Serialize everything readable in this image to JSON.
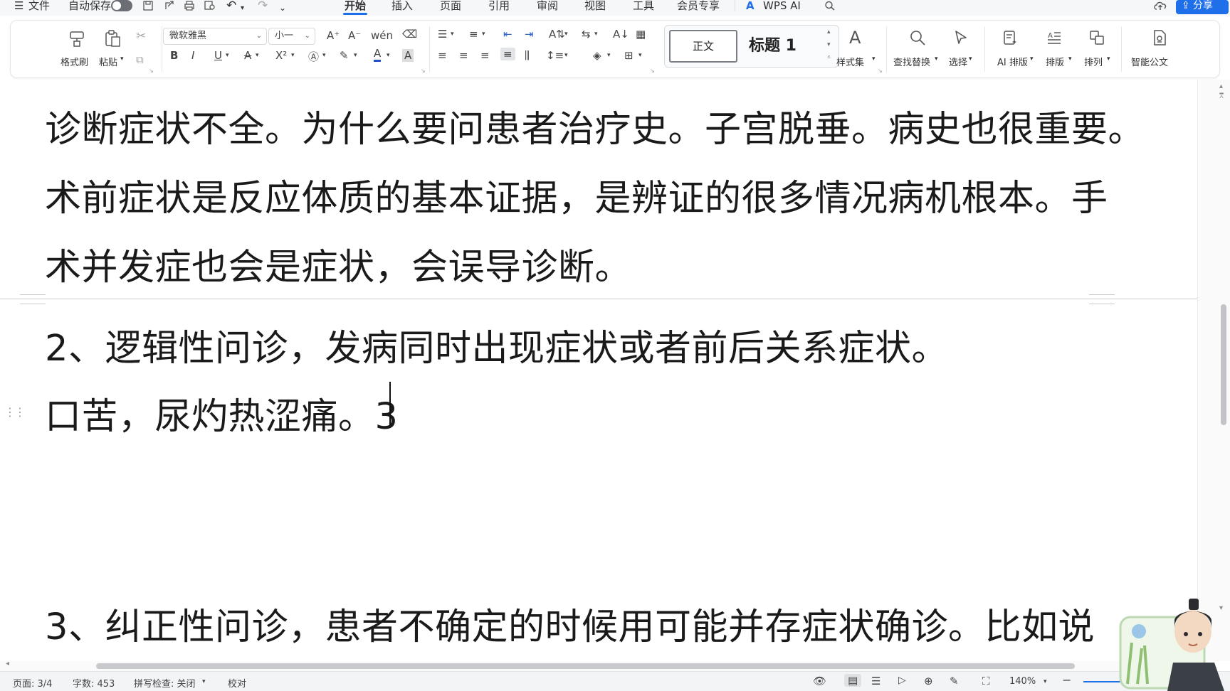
{
  "menubar": {
    "file_label": "文件",
    "autosave_label": "自动保存",
    "tabs": [
      "开始",
      "插入",
      "页面",
      "引用",
      "审阅",
      "视图",
      "工具",
      "会员专享"
    ],
    "wps_ai_label": "WPS AI",
    "share_label": "分享",
    "accent_color": "#1f6feb"
  },
  "ribbon": {
    "format_painter": "格式刷",
    "paste": "粘贴",
    "font_name": "微软雅黑",
    "font_size": "小一",
    "style_normal": "正文",
    "style_heading1": "标题 1",
    "style_set": "样式集",
    "find_replace": "查找替换",
    "select": "选择",
    "ai_layout": "AI 排版",
    "layout": "排版",
    "arrange": "排列",
    "smart_doc": "智能公文"
  },
  "document": {
    "lines": [
      "诊断症状不全。为什么要问患者治疗史。子宫脱垂。病史也很重要。",
      "术前症状是反应体质的基本证据，是辨证的很多情况病机根本。手",
      "术并发症也会是症状，会误导诊断。",
      "2、逻辑性问诊，发病同时出现症状或者前后关系症状。",
      "口苦，尿灼热涩痛。3",
      "3、纠正性问诊，患者不确定的时候用可能并存症状确诊。比如说"
    ]
  },
  "statusbar": {
    "page": "页面: 3/4",
    "word_count": "字数: 453",
    "spell_check": "拼写检查: 关闭",
    "proofread": "校对",
    "zoom": "140%"
  }
}
